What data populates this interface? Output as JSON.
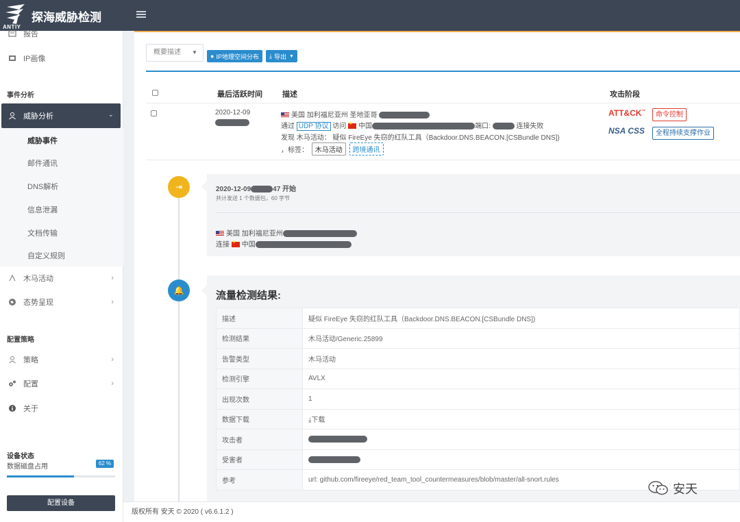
{
  "app": {
    "title": "探海威胁检测",
    "logo_text": "ANTIY"
  },
  "sidebar": {
    "top_items": [
      {
        "label": "报告",
        "icon": "report-icon"
      },
      {
        "label": "IP画像",
        "icon": "ip-profile-icon"
      }
    ],
    "section_event": "事件分析",
    "active_item": "威胁分析",
    "threat_sub_items": [
      {
        "label": "威胁事件",
        "active": true
      },
      {
        "label": "邮件通讯"
      },
      {
        "label": "DNS解析"
      },
      {
        "label": "信息泄漏"
      },
      {
        "label": "文档传输"
      },
      {
        "label": "自定义规则"
      }
    ],
    "items_after": [
      {
        "label": "木马活动",
        "icon": "trojan-icon"
      },
      {
        "label": "态势呈现",
        "icon": "globe-icon"
      }
    ],
    "section_config": "配置策略",
    "config_items": [
      {
        "label": "策略",
        "icon": "policy-icon"
      },
      {
        "label": "配置",
        "icon": "gears-icon"
      },
      {
        "label": "关于",
        "icon": "info-icon"
      }
    ],
    "device_status": {
      "title": "设备状态",
      "disk_label": "数据磁盘占用",
      "disk_percent": "62 %",
      "disk_fraction": 0.62,
      "button": "配置设备"
    }
  },
  "toolbar": {
    "filter_placeholder": "概要描述",
    "geo_button": "IP地理空间分布",
    "export_button": "导出"
  },
  "table": {
    "headers": {
      "time": "最后活跃时间",
      "desc": "描述",
      "stage": "攻击阶段"
    },
    "row": {
      "date": "2020-12-09",
      "line1_country": "美国 加利福尼亚州 圣地亚哥",
      "line2_via": "通过",
      "line2_protocol": "UDP 协议",
      "line2_access": "访问",
      "line2_country": "中国",
      "line2_port": "端口:",
      "line2_fail": "连接失败",
      "line3": "发现 木马活动：  疑似 FireEye 失窃的红队工具（Backdoor.DNS.BEACON.[CSBundle DNS])",
      "line4_prefix": "，标签：",
      "tag1": "木马活动",
      "tag2": "跨境通讯",
      "attck_logo": "ATT&CK",
      "attck_tm": "™",
      "stage1": "命令控制",
      "nsa_logo": "NSA CSS",
      "stage2": "全程持续支撑作业"
    }
  },
  "timeline": {
    "event1": {
      "date": "2020-12-09",
      "time_tail": "47 开始",
      "summary": "共计发送 1 个数据包，60 字节",
      "from_country": "美国 加利福尼亚州",
      "connect": "连接",
      "to_country": "中国"
    },
    "event2": {
      "title": "流量检测结果:",
      "rows": [
        {
          "k": "描述",
          "v": "疑似 FireEye 失窃的红队工具（Backdoor.DNS.BEACON.[CSBundle DNS])"
        },
        {
          "k": "检测结果",
          "v": "木马活动/Generic.25899"
        },
        {
          "k": "告警类型",
          "v": "木马活动"
        },
        {
          "k": "检测引擎",
          "v": "AVLX"
        },
        {
          "k": "出现次数",
          "v": "1"
        },
        {
          "k": "数据下载",
          "v": "下载"
        },
        {
          "k": "攻击者",
          "v": ""
        },
        {
          "k": "受害者",
          "v": ""
        },
        {
          "k": "参考",
          "v": "url: github.com/fireeye/red_team_tool_countermeasures/blob/master/all-snort.rules"
        }
      ]
    }
  },
  "footer": "版权所有 安天 © 2020 ( v6.6.1.2 )",
  "watermark": "安天",
  "colors": {
    "primary": "#2b8ccd",
    "dark": "#3c4655",
    "accent": "#f0ad4e",
    "danger": "#e03a2f"
  }
}
